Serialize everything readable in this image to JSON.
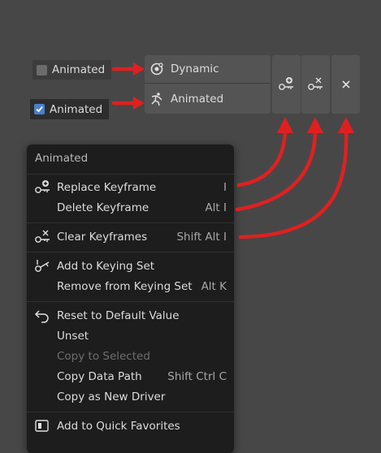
{
  "checkbox_unchecked": {
    "label": "Animated"
  },
  "checkbox_checked": {
    "label": "Animated"
  },
  "buttons": {
    "dynamic_label": "Dynamic",
    "animated_label": "Animated"
  },
  "menu": {
    "title": "Animated",
    "items": [
      {
        "label": "Replace Keyframe",
        "shortcut": "I"
      },
      {
        "label": "Delete Keyframe",
        "shortcut": "Alt I"
      },
      {
        "label": "Clear Keyframes",
        "shortcut": "Shift Alt I"
      },
      {
        "label": "Add to Keying Set",
        "shortcut": ""
      },
      {
        "label": "Remove from Keying Set",
        "shortcut": "Alt K"
      },
      {
        "label": "Reset to Default Value",
        "shortcut": ""
      },
      {
        "label": "Unset",
        "shortcut": ""
      },
      {
        "label": "Copy to Selected",
        "shortcut": ""
      },
      {
        "label": "Copy Data Path",
        "shortcut": "Shift Ctrl C"
      },
      {
        "label": "Copy as New Driver",
        "shortcut": ""
      },
      {
        "label": "Add to Quick Favorites",
        "shortcut": ""
      }
    ]
  },
  "colors": {
    "arrow": "#e02020",
    "checkbox_checked": "#4a7fd0",
    "menu_bg": "#1d1d1d"
  }
}
